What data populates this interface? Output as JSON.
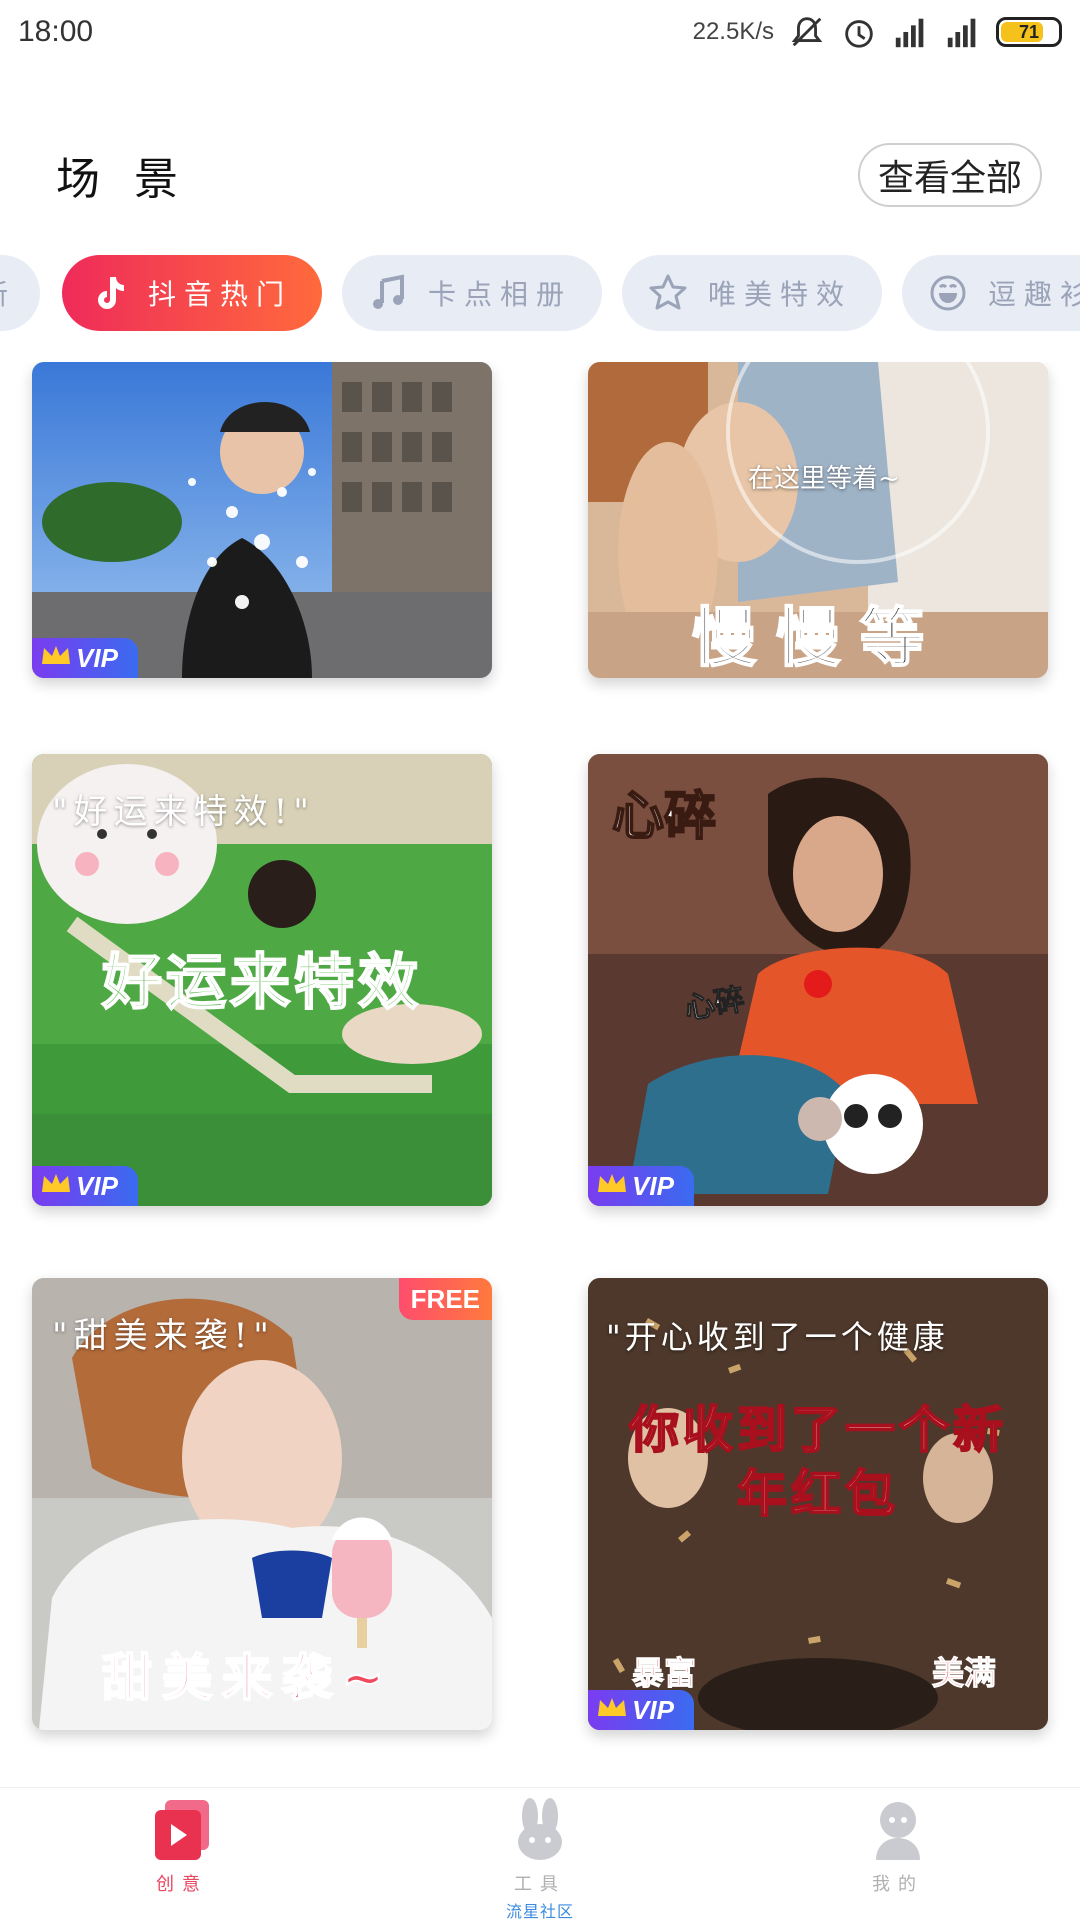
{
  "status_bar": {
    "time": "18:00",
    "speed": "22.5K/s",
    "battery": "71",
    "signal_label": "4G"
  },
  "header": {
    "title": "场 景",
    "view_all": "查看全部"
  },
  "tabs": [
    {
      "label": "新",
      "icon": "partial"
    },
    {
      "label": "抖音热门",
      "icon": "tiktok-icon",
      "active": true
    },
    {
      "label": "卡点相册",
      "icon": "music-note-icon"
    },
    {
      "label": "唯美特效",
      "icon": "star-icon"
    },
    {
      "label": "逗趣衫",
      "icon": "smile-icon"
    }
  ],
  "cards": [
    {
      "caption_top": "",
      "caption_big": "",
      "badge": "VIP"
    },
    {
      "caption_top": "在这里等着~",
      "caption_big": "慢慢等",
      "badge": ""
    },
    {
      "caption_top": "\"好运来特效!\"",
      "caption_big": "好运来特效",
      "badge": "VIP"
    },
    {
      "caption_top": "心碎",
      "caption_big": "心碎",
      "badge": "VIP"
    },
    {
      "caption_top": "\"甜美来袭!\"",
      "caption_big": "甜美来袭~",
      "badge": "FREE"
    },
    {
      "caption_top": "\"开心收到了一个健康",
      "caption_big": "你收到了一个新年红包",
      "badge": "VIP"
    }
  ],
  "card_extra": {
    "c6_bottom_left": "暴富",
    "c6_bottom_right": "美满"
  },
  "bottom_nav": {
    "create": "创意",
    "tools": "工具",
    "tools_sub": "流星社区",
    "mine": "我的"
  },
  "colors": {
    "accent": "#ef2b5a",
    "tab_inactive_bg": "#e8ecf5",
    "vip_gradient_start": "#7a3cf0"
  }
}
